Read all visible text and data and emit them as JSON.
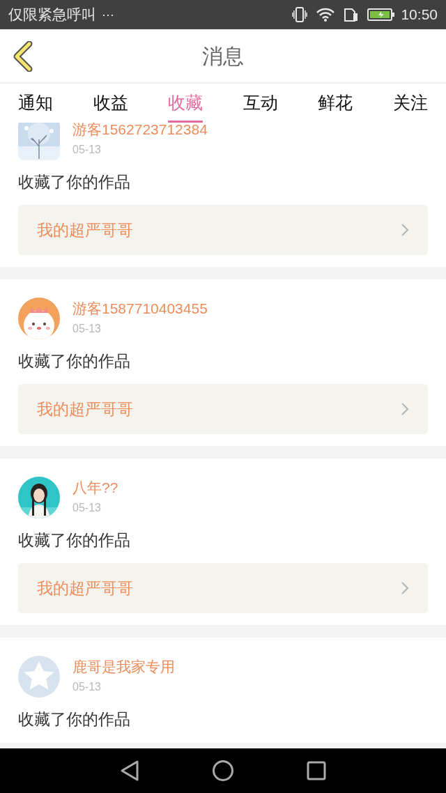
{
  "status_bar": {
    "carrier": "仅限紧急呼叫",
    "more": "···",
    "time": "10:50"
  },
  "header": {
    "title": "消息"
  },
  "tabs": [
    {
      "label": "通知",
      "selected": false
    },
    {
      "label": "收益",
      "selected": false
    },
    {
      "label": "收藏",
      "selected": true
    },
    {
      "label": "互动",
      "selected": false
    },
    {
      "label": "鲜花",
      "selected": false
    },
    {
      "label": "关注",
      "selected": false
    }
  ],
  "messages": [
    {
      "name": "游客1562723712384",
      "date": "05-13",
      "action": "收藏了你的作品",
      "work_title": "我的超严哥哥"
    },
    {
      "name": "游客1587710403455",
      "date": "05-13",
      "action": "收藏了你的作品",
      "work_title": "我的超严哥哥"
    },
    {
      "name": "八年??",
      "date": "05-13",
      "action": "收藏了你的作品",
      "work_title": "我的超严哥哥"
    },
    {
      "avatar": {
        "kind": "default"
      },
      "name": "鹿哥是我家专用",
      "date": "05-13",
      "action": "收藏了你的作品"
    }
  ]
}
